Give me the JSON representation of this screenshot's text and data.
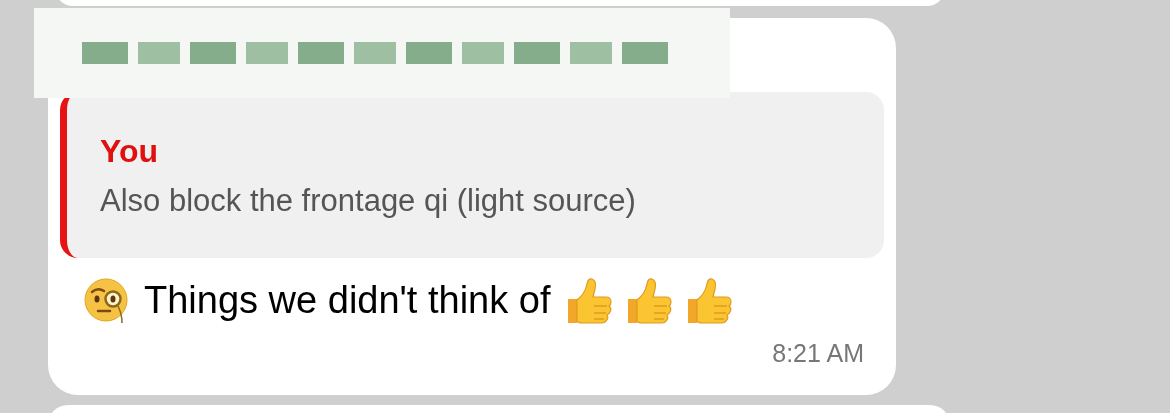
{
  "message": {
    "quote": {
      "author": "You",
      "text": "Also block the frontage qi (light source)"
    },
    "segments": [
      {
        "kind": "monocle"
      },
      {
        "kind": "text",
        "text": "Things we didn't think of"
      },
      {
        "kind": "thumbs_up"
      },
      {
        "kind": "thumbs_up"
      },
      {
        "kind": "thumbs_up"
      }
    ],
    "time": "8:21 AM"
  }
}
